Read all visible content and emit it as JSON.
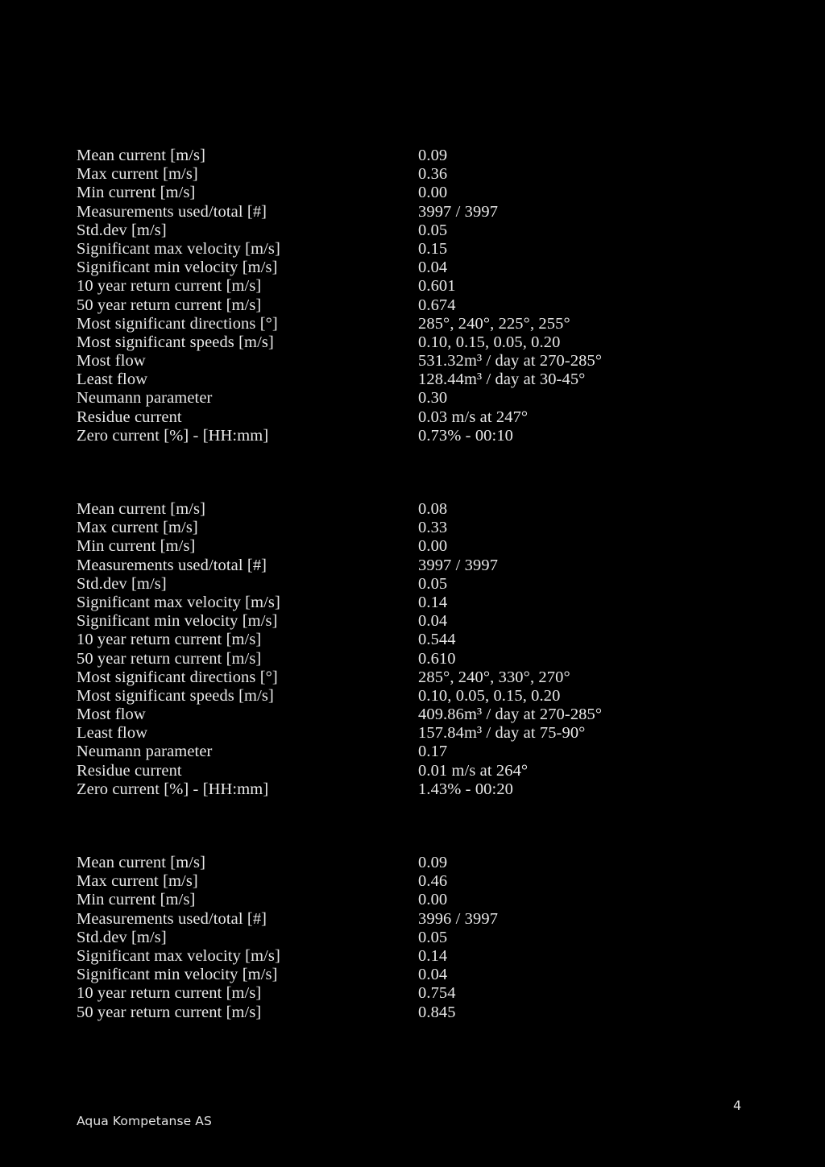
{
  "document": {
    "page_number": "4",
    "footer_company": "Aqua Kompetanse AS",
    "background_color": "#000000",
    "text_color": "#e8e8e8"
  },
  "blocks": [
    {
      "id": "current-statistics-block-1",
      "rows": [
        {
          "label": "Mean current [m/s]",
          "value": "0.09"
        },
        {
          "label": "Max current [m/s]",
          "value": "0.36"
        },
        {
          "label": "Min current [m/s]",
          "value": "0.00"
        },
        {
          "label": "Measurements used/total [#]",
          "value": "3997 / 3997"
        },
        {
          "label": "Std.dev [m/s]",
          "value": "0.05"
        },
        {
          "label": "Significant max velocity [m/s]",
          "value": "0.15"
        },
        {
          "label": "Significant min velocity [m/s]",
          "value": "0.04"
        },
        {
          "label": "10 year return current [m/s]",
          "value": "0.601"
        },
        {
          "label": "50 year return current [m/s]",
          "value": "0.674"
        },
        {
          "label": "Most significant directions [°]",
          "value": "285°, 240°, 225°, 255°"
        },
        {
          "label": "Most significant speeds [m/s]",
          "value": "0.10, 0.15, 0.05, 0.20"
        },
        {
          "label": "Most flow",
          "value": "531.32m³ / day at 270-285°"
        },
        {
          "label": "Least flow",
          "value": "128.44m³ / day at 30-45°"
        },
        {
          "label": "Neumann parameter",
          "value": "0.30"
        },
        {
          "label": "Residue current",
          "value": "0.03 m/s at 247°"
        },
        {
          "label": "Zero current [%] - [HH:mm]",
          "value": "0.73% - 00:10"
        }
      ]
    },
    {
      "id": "current-statistics-block-2",
      "rows": [
        {
          "label": "Mean current [m/s]",
          "value": "0.08"
        },
        {
          "label": "Max current [m/s]",
          "value": "0.33"
        },
        {
          "label": "Min current [m/s]",
          "value": "0.00"
        },
        {
          "label": "Measurements used/total [#]",
          "value": "3997 / 3997"
        },
        {
          "label": "Std.dev [m/s]",
          "value": "0.05"
        },
        {
          "label": "Significant max velocity [m/s]",
          "value": "0.14"
        },
        {
          "label": "Significant min velocity [m/s]",
          "value": "0.04"
        },
        {
          "label": "10 year return current [m/s]",
          "value": "0.544"
        },
        {
          "label": "50 year return current [m/s]",
          "value": "0.610"
        },
        {
          "label": "Most significant directions [°]",
          "value": "285°, 240°, 330°, 270°"
        },
        {
          "label": "Most significant speeds [m/s]",
          "value": "0.10, 0.05, 0.15, 0.20"
        },
        {
          "label": "Most flow",
          "value": "409.86m³ / day at 270-285°"
        },
        {
          "label": "Least flow",
          "value": "157.84m³ / day at 75-90°"
        },
        {
          "label": "Neumann parameter",
          "value": "0.17"
        },
        {
          "label": "Residue current",
          "value": "0.01 m/s at 264°"
        },
        {
          "label": "Zero current [%] - [HH:mm]",
          "value": "1.43% - 00:20"
        }
      ]
    },
    {
      "id": "current-statistics-block-3",
      "rows": [
        {
          "label": "Mean current [m/s]",
          "value": "0.09"
        },
        {
          "label": "Max current [m/s]",
          "value": "0.46"
        },
        {
          "label": "Min current [m/s]",
          "value": "0.00"
        },
        {
          "label": "Measurements used/total [#]",
          "value": "3996 / 3997"
        },
        {
          "label": "Std.dev [m/s]",
          "value": "0.05"
        },
        {
          "label": "Significant max velocity [m/s]",
          "value": "0.14"
        },
        {
          "label": "Significant min velocity [m/s]",
          "value": "0.04"
        },
        {
          "label": "10 year return current [m/s]",
          "value": "0.754"
        },
        {
          "label": "50 year return current [m/s]",
          "value": "0.845"
        }
      ]
    }
  ]
}
